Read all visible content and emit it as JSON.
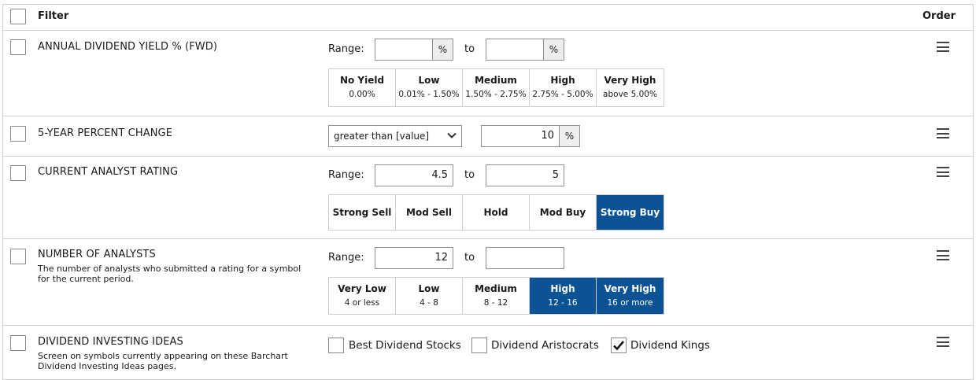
{
  "header": {
    "filter_label": "Filter",
    "order_label": "Order"
  },
  "rows": {
    "dividend_yield": {
      "title": "ANNUAL DIVIDEND YIELD % (FWD)",
      "range_label": "Range:",
      "to_label": "to",
      "from_value": "",
      "to_value": "",
      "unit": "%",
      "options": [
        {
          "title": "No Yield",
          "sub": "0.00%",
          "active": false
        },
        {
          "title": "Low",
          "sub": "0.01% - 1.50%",
          "active": false
        },
        {
          "title": "Medium",
          "sub": "1.50% - 2.75%",
          "active": false
        },
        {
          "title": "High",
          "sub": "2.75% - 5.00%",
          "active": false
        },
        {
          "title": "Very High",
          "sub": "above 5.00%",
          "active": false
        }
      ]
    },
    "five_year_change": {
      "title": "5-YEAR PERCENT CHANGE",
      "select_value": "greater than [value]",
      "value": "10",
      "unit": "%"
    },
    "analyst_rating": {
      "title": "CURRENT ANALYST RATING",
      "range_label": "Range:",
      "to_label": "to",
      "from_value": "4.5",
      "to_value": "5",
      "options": [
        {
          "title": "Strong Sell",
          "active": false
        },
        {
          "title": "Mod Sell",
          "active": false
        },
        {
          "title": "Hold",
          "active": false
        },
        {
          "title": "Mod Buy",
          "active": false
        },
        {
          "title": "Strong Buy",
          "active": true
        }
      ]
    },
    "num_analysts": {
      "title": "NUMBER OF ANALYSTS",
      "description": "The number of analysts who submitted a rating for a symbol for the current period.",
      "range_label": "Range:",
      "to_label": "to",
      "from_value": "12",
      "to_value": "",
      "options": [
        {
          "title": "Very Low",
          "sub": "4 or less",
          "active": false
        },
        {
          "title": "Low",
          "sub": "4 - 8",
          "active": false
        },
        {
          "title": "Medium",
          "sub": "8 - 12",
          "active": false
        },
        {
          "title": "High",
          "sub": "12 - 16",
          "active": true
        },
        {
          "title": "Very High",
          "sub": "16 or more",
          "active": true
        }
      ]
    },
    "investing_ideas": {
      "title": "DIVIDEND INVESTING IDEAS",
      "description": "Screen on symbols currently appearing on these Barchart Dividend Investing Ideas pages.",
      "choices": [
        {
          "label": "Best Dividend Stocks",
          "checked": false
        },
        {
          "label": "Dividend Aristocrats",
          "checked": false
        },
        {
          "label": "Dividend Kings",
          "checked": true
        }
      ]
    }
  },
  "colors": {
    "accent": "#0b5394",
    "border": "#cfcfcf",
    "unit_bg": "#eeeeee"
  },
  "icons": {
    "order": "hamburger-icon",
    "select": "chevron-down-icon",
    "check": "checkmark-icon"
  }
}
